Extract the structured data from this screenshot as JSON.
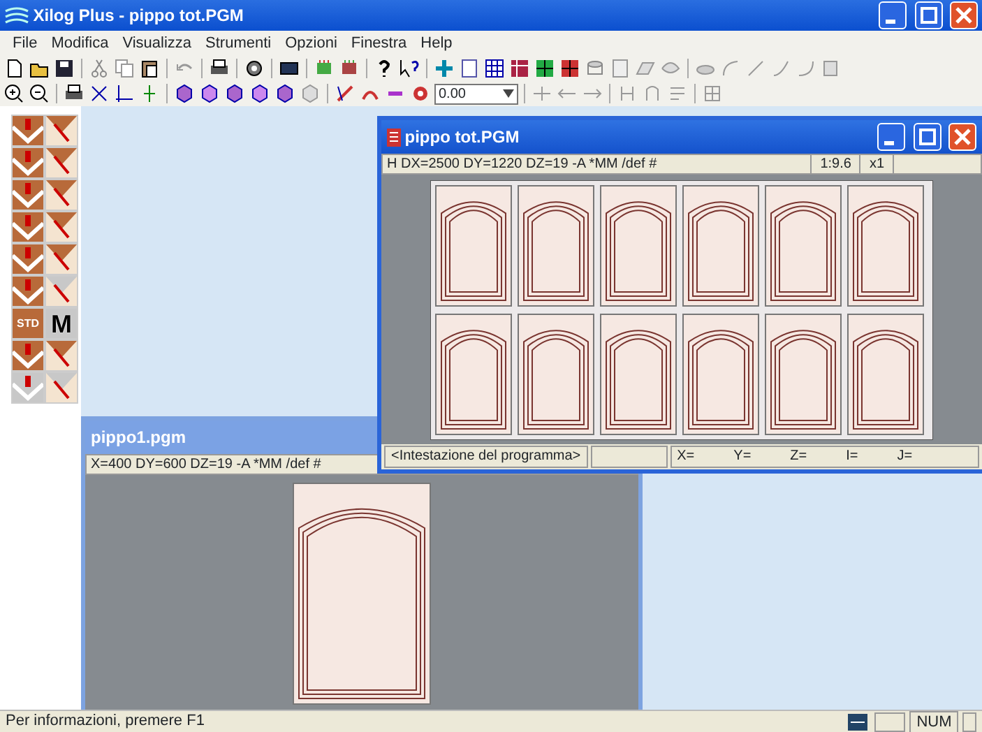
{
  "window": {
    "title": "Xilog Plus - pippo tot.PGM"
  },
  "menu": [
    "File",
    "Modifica",
    "Visualizza",
    "Strumenti",
    "Opzioni",
    "Finestra",
    "Help"
  ],
  "toolbar": {
    "scale_field": "0.00"
  },
  "palette": [
    {
      "kind": "brown"
    },
    {
      "kind": "brown"
    },
    {
      "kind": "brown"
    },
    {
      "kind": "brown"
    },
    {
      "kind": "brown"
    },
    {
      "kind": "brown"
    },
    {
      "kind": "brown"
    },
    {
      "kind": "brown"
    },
    {
      "kind": "brown"
    },
    {
      "kind": "brown"
    },
    {
      "kind": "brown"
    },
    {
      "kind": "gray"
    },
    {
      "kind": "brown",
      "label": "STD"
    },
    {
      "kind": "gray",
      "label": "M"
    },
    {
      "kind": "brown"
    },
    {
      "kind": "brown"
    },
    {
      "kind": "gray"
    },
    {
      "kind": "gray"
    }
  ],
  "child_windows": [
    {
      "title": "pippo1.pgm",
      "active": false,
      "kind": "single",
      "header": "X=400 DY=600 DZ=19 -A *MM /def #"
    },
    {
      "title": "pippo tot.PGM",
      "active": true,
      "kind": "nesting",
      "header": "H DX=2500 DY=1220 DZ=19 -A *MM /def #",
      "scale": "1:9.6",
      "zoom": "x1",
      "message": "<Intestazione del programma>",
      "coords": [
        "X=",
        "Y=",
        "Z=",
        "I=",
        "J="
      ]
    }
  ],
  "status_bar": {
    "message": "Per informazioni, premere F1",
    "indicator": "NUM"
  }
}
